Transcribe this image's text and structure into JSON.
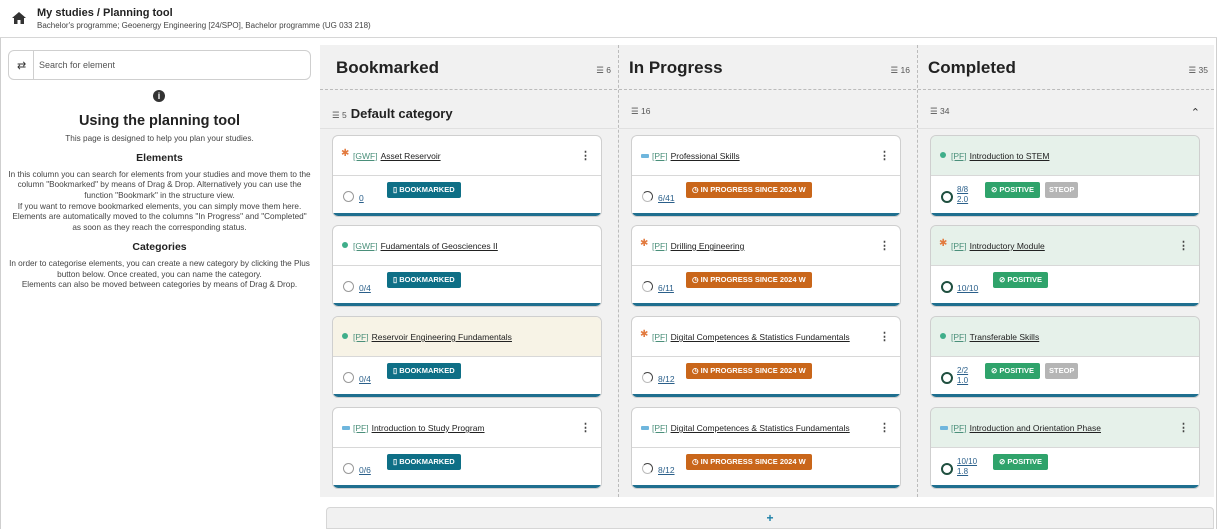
{
  "header": {
    "title": "My studies / Planning tool",
    "subtitle": "Bachelor's programme; Geoenergy Engineering [24/SPO], Bachelor programme (UG 033 218)"
  },
  "search": {
    "placeholder": "Search for element"
  },
  "help": {
    "title": "Using the planning tool",
    "intro": "This page is designed to help you plan your studies.",
    "elements_heading": "Elements",
    "elements_p1": "In this column you can search for elements from your studies and move them to the column \"Bookmarked\" by means of Drag & Drop. Alternatively you can use the function \"Bookmark\" in the structure view.",
    "elements_p2": "If you want to remove bookmarked elements, you can simply move them here.",
    "elements_p3": "Elements are automatically moved to the columns \"In Progress\" and \"Completed\" as soon as they reach the corresponding status.",
    "categories_heading": "Categories",
    "categories_p1": "In order to categorise elements, you can create a new category by clicking the Plus button below. Once created, you can name the category.",
    "categories_p2": "Elements can also be moved between categories by means of Drag & Drop."
  },
  "columns": [
    {
      "title": "Bookmarked",
      "count": "6",
      "cat_count": "5",
      "cat_name": "Default category",
      "cards": [
        {
          "code": "[GWF]",
          "name": "Asset Reservoir",
          "progress": "0",
          "badge": "BOOKMARKED",
          "marker": "star"
        },
        {
          "code": "[GWF]",
          "name": "Fudamentals of Geosciences II",
          "progress": "0/4",
          "badge": "BOOKMARKED",
          "marker": "green"
        },
        {
          "code": "[PF]",
          "name": "Reservoir Engineering Fundamentals",
          "progress": "0/4",
          "badge": "BOOKMARKED",
          "marker": "green"
        },
        {
          "code": "[PF]",
          "name": "Introduction to Study Program",
          "progress": "0/6",
          "badge": "BOOKMARKED",
          "marker": "blue"
        }
      ]
    },
    {
      "title": "In Progress",
      "count": "16",
      "cat_count": "16",
      "cards": [
        {
          "code": "[PF]",
          "name": "Professional Skills",
          "progress": "6/41",
          "badge": "IN PROGRESS SINCE 2024 W",
          "marker": "blue"
        },
        {
          "code": "[PF]",
          "name": "Drilling Engineering",
          "progress": "6/11",
          "badge": "IN PROGRESS SINCE 2024 W",
          "marker": "star"
        },
        {
          "code": "[PF]",
          "name": "Digital Competences & Statistics Fundamentals",
          "progress": "8/12",
          "badge": "IN PROGRESS SINCE 2024 W",
          "marker": "star"
        },
        {
          "code": "[PF]",
          "name": "Digital Competences & Statistics Fundamentals",
          "progress": "8/12",
          "badge": "IN PROGRESS SINCE 2024 W",
          "marker": "blue"
        }
      ]
    },
    {
      "title": "Completed",
      "count": "35",
      "cat_count": "34",
      "cards": [
        {
          "code": "[PF]",
          "name": "Introduction to STEM",
          "progress": "8/8",
          "grade": "2.0",
          "badge": "POSITIVE",
          "steop": "STEOP",
          "marker": "green"
        },
        {
          "code": "[PF]",
          "name": "Introductory Module",
          "progress": "10/10",
          "badge": "POSITIVE",
          "marker": "star"
        },
        {
          "code": "[PF]",
          "name": "Transferable Skills",
          "progress": "2/2",
          "grade": "1.0",
          "badge": "POSITIVE",
          "steop": "STEOP",
          "marker": "green"
        },
        {
          "code": "[PF]",
          "name": "Introduction and Orientation Phase",
          "progress": "10/10",
          "grade": "1.8",
          "badge": "POSITIVE",
          "marker": "blue"
        }
      ]
    }
  ],
  "add_button": "+"
}
